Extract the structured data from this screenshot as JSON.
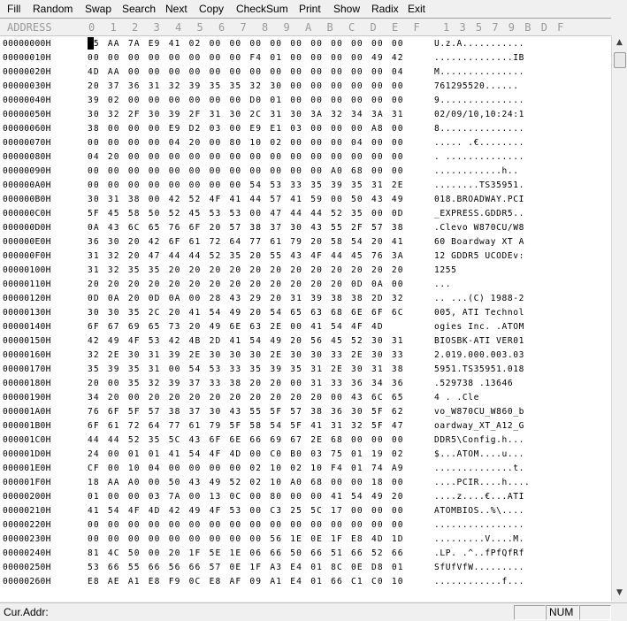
{
  "menu": [
    "Fill",
    "Random",
    "Swap",
    "Search",
    "Next",
    "Copy",
    "CheckSum",
    "Print",
    "Show",
    "Radix",
    "Exit"
  ],
  "header": {
    "address": "ADDRESS",
    "columns": [
      "0",
      "1",
      "2",
      "3",
      "4",
      "5",
      "6",
      "7",
      "8",
      "9",
      "A",
      "B",
      "C",
      "D",
      "E",
      "F"
    ],
    "ascii_ruler": "1 3 5 7 9 B D F"
  },
  "rows": [
    {
      "addr": "00000000H",
      "hex": "55 AA 7A E9 41 02 00 00 00 00 00 00 00 00 00 00",
      "ascii": "U.z.A..........."
    },
    {
      "addr": "00000010H",
      "hex": "00 00 00 00 00 00 00 00 F4 01 00 00 00 00 49 42",
      "ascii": "..............IB"
    },
    {
      "addr": "00000020H",
      "hex": "4D AA 00 00 00 00 00 00 00 00 00 00 00 00 00 04",
      "ascii": "M..............."
    },
    {
      "addr": "00000030H",
      "hex": "20 37 36 31 32 39 35 35 32 30 00 00 00 00 00 00",
      "ascii": " 761295520......"
    },
    {
      "addr": "00000040H",
      "hex": "39 02 00 00 00 00 00 00 D0 01 00 00 00 00 00 00",
      "ascii": "9..............."
    },
    {
      "addr": "00000050H",
      "hex": "30 32 2F 30 39 2F 31 30 2C 31 30 3A 32 34 3A 31",
      "ascii": "02/09/10,10:24:1"
    },
    {
      "addr": "00000060H",
      "hex": "38 00 00 00 E9 D2 03 00 E9 E1 03 00 00 00 A8 00",
      "ascii": "8..............."
    },
    {
      "addr": "00000070H",
      "hex": "00 00 00 00 04 20 00 80 10 02 00 00 00 04 00 00",
      "ascii": "..... .€........"
    },
    {
      "addr": "00000080H",
      "hex": "04 20 00 00 00 00 00 00 00 00 00 00 00 00 00 00",
      "ascii": ". .............."
    },
    {
      "addr": "00000090H",
      "hex": "00 00 00 00 00 00 00 00 00 00 00 00 A0 68 00 00",
      "ascii": "............h.."
    },
    {
      "addr": "000000A0H",
      "hex": "00 00 00 00 00 00 00 00 54 53 33 35 39 35 31 2E",
      "ascii": "........TS35951."
    },
    {
      "addr": "000000B0H",
      "hex": "30 31 38 00 42 52 4F 41 44 57 41 59 00 50 43 49",
      "ascii": "018.BROADWAY.PCI"
    },
    {
      "addr": "000000C0H",
      "hex": "5F 45 58 50 52 45 53 53 00 47 44 44 52 35 00 0D",
      "ascii": "_EXPRESS.GDDR5.."
    },
    {
      "addr": "000000D0H",
      "hex": "0A 43 6C 65 76 6F 20 57 38 37 30 43 55 2F 57 38",
      "ascii": ".Clevo W870CU/W8"
    },
    {
      "addr": "000000E0H",
      "hex": "36 30 20 42 6F 61 72 64 77 61 79 20 58 54 20 41",
      "ascii": "60 Boardway XT A"
    },
    {
      "addr": "000000F0H",
      "hex": "31 32 20 47 44 44 52 35 20 55 43 4F 44 45 76 3A",
      "ascii": "12 GDDR5 UCODEv:"
    },
    {
      "addr": "00000100H",
      "hex": "31 32 35 35 20 20 20 20 20 20 20 20 20 20 20 20",
      "ascii": "1255"
    },
    {
      "addr": "00000110H",
      "hex": "20 20 20 20 20 20 20 20 20 20 20 20 20 0D 0A 00",
      "ascii": "             ..."
    },
    {
      "addr": "00000120H",
      "hex": "0D 0A 20 0D 0A 00 28 43 29 20 31 39 38 38 2D 32",
      "ascii": ".. ...(C) 1988-2"
    },
    {
      "addr": "00000130H",
      "hex": "30 30 35 2C 20 41 54 49 20 54 65 63 68 6E 6F 6C",
      "ascii": "005, ATI Technol"
    },
    {
      "addr": "00000140H",
      "hex": "6F 67 69 65 73 20 49 6E 63 2E 00 41 54 4F 4D",
      "ascii": "ogies Inc. .ATOM"
    },
    {
      "addr": "00000150H",
      "hex": "42 49 4F 53 42 4B 2D 41 54 49 20 56 45 52 30 31",
      "ascii": "BIOSBK-ATI VER01"
    },
    {
      "addr": "00000160H",
      "hex": "32 2E 30 31 39 2E 30 30 30 2E 30 30 33 2E 30 33",
      "ascii": "2.019.000.003.03"
    },
    {
      "addr": "00000170H",
      "hex": "35 39 35 31 00 54 53 33 35 39 35 31 2E 30 31 38",
      "ascii": "5951.TS35951.018"
    },
    {
      "addr": "00000180H",
      "hex": "20 00 35 32 39 37 33 38 20 20 00 31 33 36 34 36",
      "ascii": " .529738  .13646"
    },
    {
      "addr": "00000190H",
      "hex": "34 20 00 20 20 20 20 20 20 20 20 20 00 43 6C 65",
      "ascii": "4 .         .Cle"
    },
    {
      "addr": "000001A0H",
      "hex": "76 6F 5F 57 38 37 30 43 55 5F 57 38 36 30 5F 62",
      "ascii": "vo_W870CU_W860_b"
    },
    {
      "addr": "000001B0H",
      "hex": "6F 61 72 64 77 61 79 5F 58 54 5F 41 31 32 5F 47",
      "ascii": "oardway_XT_A12_G"
    },
    {
      "addr": "000001C0H",
      "hex": "44 44 52 35 5C 43 6F 6E 66 69 67 2E 68 00 00 00",
      "ascii": "DDR5\\Config.h..."
    },
    {
      "addr": "000001D0H",
      "hex": "24 00 01 01 41 54 4F 4D 00 C0 B0 03 75 01 19 02",
      "ascii": "$...ATOM....u..."
    },
    {
      "addr": "000001E0H",
      "hex": "CF 00 10 04 00 00 00 00 02 10 02 10 F4 01 74 A9",
      "ascii": "..............t."
    },
    {
      "addr": "000001F0H",
      "hex": "18 AA A0 00 50 43 49 52 02 10 A0 68 00 00 18 00",
      "ascii": "....PCIR....h...."
    },
    {
      "addr": "00000200H",
      "hex": "01 00 00 03 7A 00 13 0C 00 80 00 00 41 54 49 20",
      "ascii": "....z....€...ATI "
    },
    {
      "addr": "00000210H",
      "hex": "41 54 4F 4D 42 49 4F 53 00 C3 25 5C 17 00 00 00",
      "ascii": "ATOMBIOS..%\\...."
    },
    {
      "addr": "00000220H",
      "hex": "00 00 00 00 00 00 00 00 00 00 00 00 00 00 00 00",
      "ascii": "................"
    },
    {
      "addr": "00000230H",
      "hex": "00 00 00 00 00 00 00 00 00 56 1E 0E 1F E8 4D 1D",
      "ascii": ".........V....M."
    },
    {
      "addr": "00000240H",
      "hex": "81 4C 50 00 20 1F 5E 1E 06 66 50 66 51 66 52 66",
      "ascii": ".LP. .^..fPfQfRf"
    },
    {
      "addr": "00000250H",
      "hex": "53 66 55 66 56 66 57 0E 1F A3 E4 01 8C 0E D8 01",
      "ascii": "SfUfVfW........."
    },
    {
      "addr": "00000260H",
      "hex": "E8 AE A1 E8 F9 0C E8 AF 09 A1 E4 01 66 C1 C0 10",
      "ascii": "............f..."
    }
  ],
  "status": {
    "cur_addr_label": "Cur.Addr:",
    "num_label": "NUM"
  },
  "scrollbar": {
    "up_icon": "▲",
    "down_icon": "▼"
  }
}
